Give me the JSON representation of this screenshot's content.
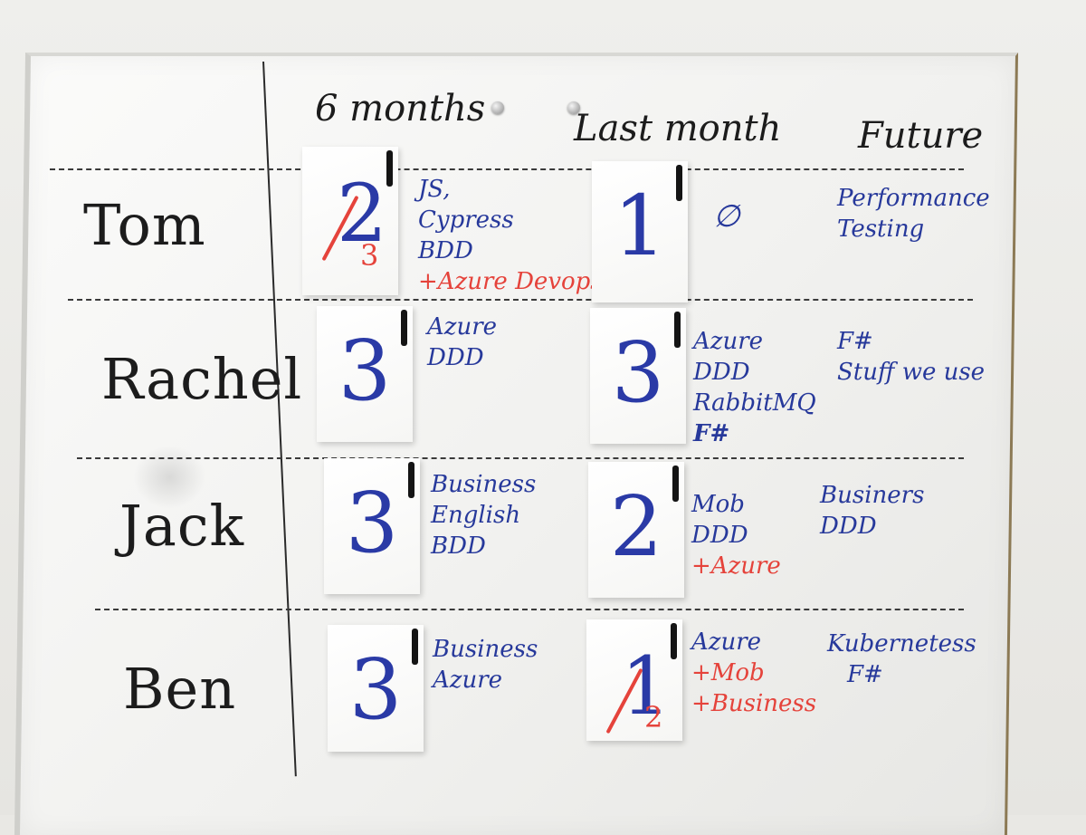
{
  "headers": [
    "6 months",
    "Last month",
    "Future"
  ],
  "rows": [
    {
      "name": "Tom",
      "six_months": {
        "score": "2",
        "new_score": "3",
        "items": [
          {
            "text": "JS,",
            "color": "blue"
          },
          {
            "text": "Cypress",
            "color": "blue"
          },
          {
            "text": "BDD",
            "color": "blue"
          },
          {
            "text": "+Azure Devops",
            "color": "red"
          }
        ]
      },
      "last_month": {
        "score": "1",
        "new_score": "",
        "items": [
          {
            "text": "∅",
            "color": "blue"
          }
        ]
      },
      "future": [
        "Performance",
        "Testing"
      ]
    },
    {
      "name": "Rachel",
      "six_months": {
        "score": "3",
        "new_score": "",
        "items": [
          {
            "text": "Azure",
            "color": "blue"
          },
          {
            "text": "DDD",
            "color": "blue"
          }
        ]
      },
      "last_month": {
        "score": "3",
        "new_score": "",
        "items": [
          {
            "text": "Azure",
            "color": "blue"
          },
          {
            "text": "DDD",
            "color": "blue"
          },
          {
            "text": "RabbitMQ",
            "color": "blue"
          },
          {
            "text": "F#",
            "color": "blue"
          }
        ]
      },
      "future": [
        "F#",
        "Stuff we use"
      ]
    },
    {
      "name": "Jack",
      "six_months": {
        "score": "3",
        "new_score": "",
        "items": [
          {
            "text": "Business",
            "color": "blue"
          },
          {
            "text": "English",
            "color": "blue"
          },
          {
            "text": "BDD",
            "color": "blue"
          }
        ]
      },
      "last_month": {
        "score": "2",
        "new_score": "",
        "items": [
          {
            "text": "Mob",
            "color": "blue"
          },
          {
            "text": "DDD",
            "color": "blue"
          },
          {
            "text": "+Azure",
            "color": "red"
          }
        ]
      },
      "future": [
        "Businers",
        "DDD"
      ]
    },
    {
      "name": "Ben",
      "six_months": {
        "score": "3",
        "new_score": "",
        "items": [
          {
            "text": "Business",
            "color": "blue"
          },
          {
            "text": "Azure",
            "color": "blue"
          }
        ]
      },
      "last_month": {
        "score": "1",
        "new_score": "2",
        "items": [
          {
            "text": "Azure",
            "color": "blue"
          },
          {
            "text": "+Mob",
            "color": "red"
          },
          {
            "text": "+Business",
            "color": "red"
          }
        ]
      },
      "future": [
        "Kubernetess",
        "F#"
      ]
    }
  ]
}
